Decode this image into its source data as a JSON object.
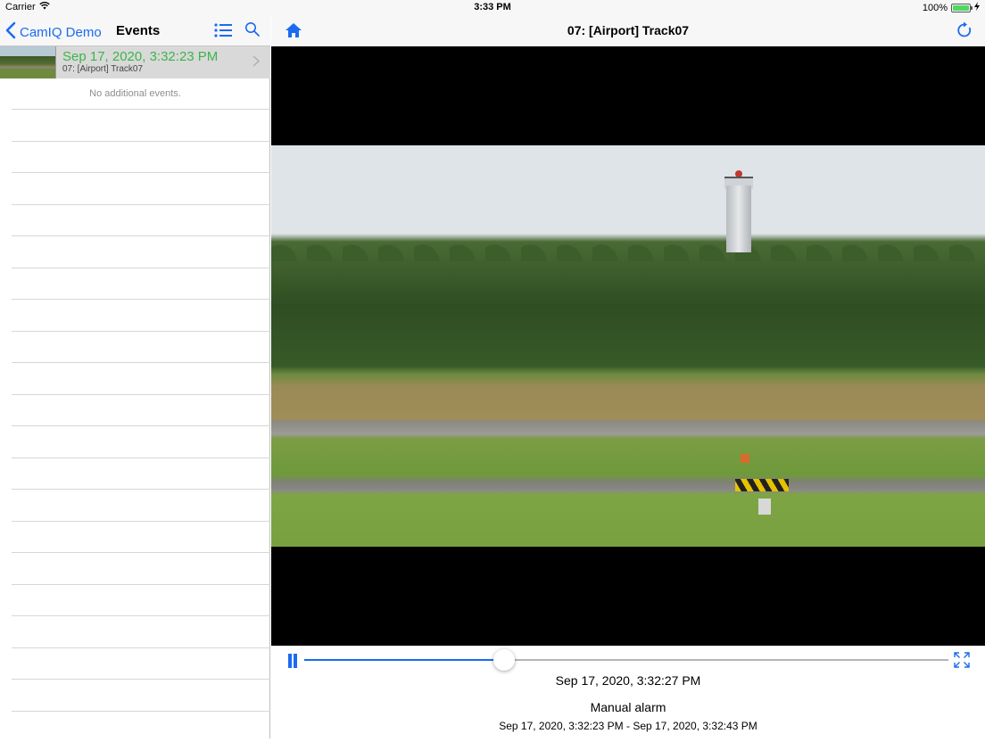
{
  "status_bar": {
    "carrier": "Carrier",
    "time": "3:33 PM",
    "battery": "100%",
    "battery_level": 1.0
  },
  "left_nav": {
    "back_label": "CamIQ Demo",
    "title": "Events",
    "list_icon": "list-icon",
    "search_icon": "search-icon"
  },
  "events": [
    {
      "time": "Sep 17, 2020, 3:32:23 PM",
      "camera": "07: [Airport] Track07"
    }
  ],
  "empty_message": "No additional events.",
  "right_nav": {
    "title": "07: [Airport] Track07",
    "home_icon": "home-icon",
    "refresh_icon": "refresh-icon"
  },
  "player": {
    "progress": 0.31,
    "current_time": "Sep 17, 2020, 3:32:27 PM",
    "alarm_type": "Manual alarm",
    "alarm_range": "Sep 17, 2020, 3:32:23 PM - Sep 17, 2020, 3:32:43 PM",
    "pause_icon": "pause-icon",
    "fullscreen_icon": "fullscreen-icon"
  },
  "colors": {
    "accent": "#1a6bf0",
    "event_time": "#3cb44b",
    "selected_row": "#d9d9d9"
  }
}
